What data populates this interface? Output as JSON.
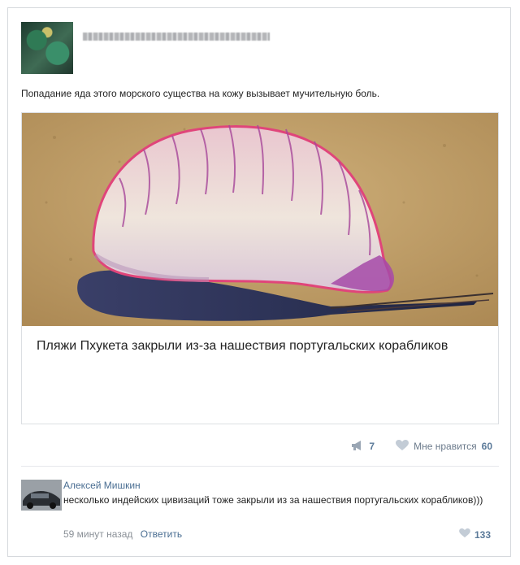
{
  "post": {
    "text": "Попадание яда этого морского существа на кожу вызывает мучительную боль.",
    "author_name_blurred": ""
  },
  "attachment": {
    "title": "Пляжи Пхукета закрыли из-за нашествия португальских корабликов"
  },
  "actions": {
    "shares_count": "7",
    "likes_label": "Мне нравится",
    "likes_count": "60"
  },
  "comment": {
    "author": "Алексей Мишкин",
    "text": "несколько индейских цивизаций тоже закрыли из за нашествия португальских корабликов)))",
    "time": "59 минут назад",
    "reply_label": "Ответить",
    "likes_count": "133"
  },
  "icons": {
    "share": "megaphone-icon",
    "like": "heart-icon",
    "comment_like": "heart-icon"
  },
  "colors": {
    "link_blue": "#4a6e92",
    "count_blue": "#5b7a99",
    "border": "#d6d9dd"
  }
}
